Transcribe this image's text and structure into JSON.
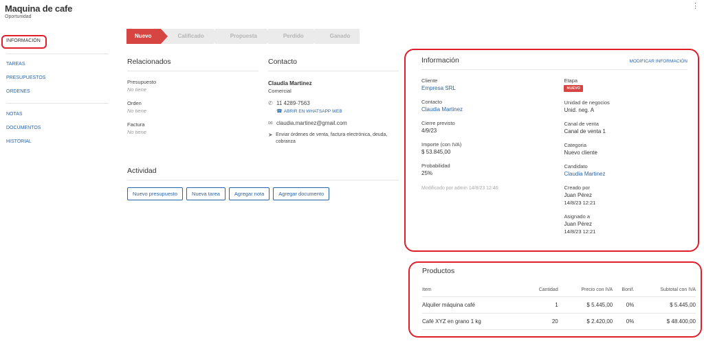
{
  "header": {
    "title": "Maquina de cafe",
    "subtitle": "Oportunidad",
    "menu_icon": "kebab-icon"
  },
  "sidebar": {
    "active": "INFORMACIÓN",
    "group1": [
      "TAREAS",
      "PRESUPUESTOS",
      "ORDENES"
    ],
    "group2": [
      "NOTAS",
      "DOCUMENTOS",
      "HISTORIAL"
    ]
  },
  "stages": [
    "Nuevo",
    "Calificado",
    "Propuesta",
    "Perdido",
    "Ganado"
  ],
  "related": {
    "title": "Relacionados",
    "fields": [
      {
        "label": "Presupuesto",
        "value": "No tiene"
      },
      {
        "label": "Orden",
        "value": "No tiene"
      },
      {
        "label": "Factura",
        "value": "No tiene"
      }
    ]
  },
  "contact": {
    "title": "Contacto",
    "name": "Claudia Martinez",
    "role": "Comercial",
    "phone": "11 4289-7563",
    "whatsapp": "ABRIR EN WHATSAPP WEB",
    "email": "claudia.martinez@gmail.com",
    "preferences": "Enviar órdenes de venta, factura electrónica, deuda, cobranza"
  },
  "activity": {
    "title": "Actividad",
    "buttons": [
      "Nuevo presupuesto",
      "Nueva tarea",
      "Agregar nota",
      "Agregar documento"
    ]
  },
  "info": {
    "title": "Información",
    "edit_link": "MODIFICAR INFORMACIÓN",
    "left": [
      {
        "label": "Cliente",
        "value": "Empresa SRL"
      },
      {
        "label": "Contacto",
        "value": "Claudia Martinez"
      },
      {
        "label": "Cierre previsto",
        "value": "4/9/23"
      },
      {
        "label": "Importe (con IVA)",
        "value": "$ 53.845,00"
      },
      {
        "label": "Probabilidad",
        "value": "25%"
      }
    ],
    "modified": "Modificado por admin 14/8/23 12:46",
    "stage_label": "Etapa",
    "stage_badge": "NUEVO",
    "right": [
      {
        "label": "Unidad de negocios",
        "value": "Unid. neg. A"
      },
      {
        "label": "Canal de venta",
        "value": "Canal de venta 1"
      },
      {
        "label": "Categoria",
        "value": "Nuevo cliente"
      },
      {
        "label": "Candidato",
        "value": "Claudia Martinez"
      }
    ],
    "created": {
      "label": "Creado por",
      "user": "Juan Pérez",
      "date": "14/8/23 12:21"
    },
    "assigned": {
      "label": "Asignado a",
      "user": "Juan Pérez",
      "date": "14/8/23 12:21"
    }
  },
  "products": {
    "title": "Productos",
    "columns": [
      "Item",
      "Cantidad",
      "Precio con IVA",
      "Bonif.",
      "Subtotal con IVA"
    ],
    "rows": [
      [
        "Alquiler máquina café",
        "1",
        "$ 5.445,00",
        "0%",
        "$ 5.445,00"
      ],
      [
        "Café XYZ en grano 1 kg",
        "20",
        "$ 2.420,00",
        "0%",
        "$ 48.400,00"
      ]
    ]
  }
}
